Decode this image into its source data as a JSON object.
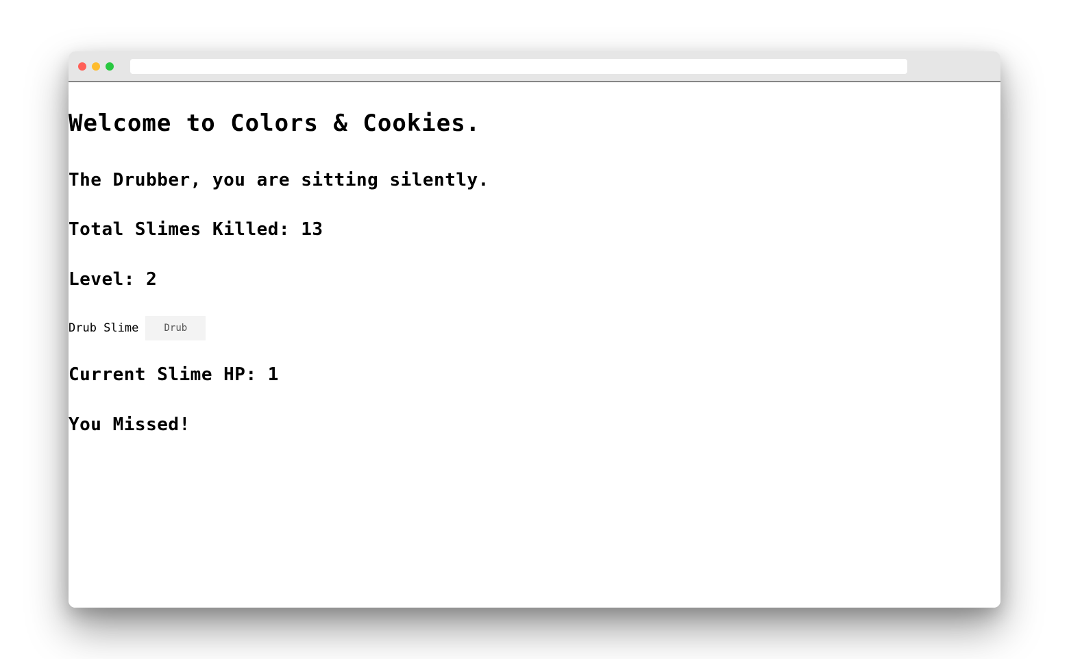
{
  "window": {
    "controls": {
      "close_color": "#ff5f57",
      "minimize_color": "#febc2e",
      "maximize_color": "#28c840"
    },
    "address_bar": {
      "value": ""
    }
  },
  "page": {
    "title": "Welcome to Colors & Cookies.",
    "status_message": "The Drubber, you are sitting silently.",
    "slimes_killed_text": "Total Slimes Killed: 13",
    "level_text": "Level: 2",
    "drub": {
      "label": "Drub Slime",
      "button_label": "Drub"
    },
    "slime_hp_text": "Current Slime HP: 1",
    "result_text": "You Missed!"
  }
}
